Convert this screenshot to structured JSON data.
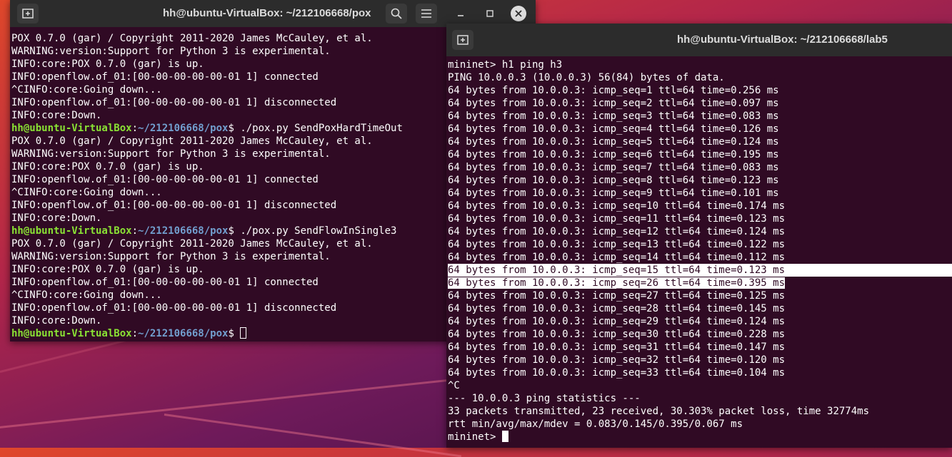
{
  "left_window": {
    "title": "hh@ubuntu-VirtualBox: ~/212106668/pox",
    "lines": [
      "POX 0.7.0 (gar) / Copyright 2011-2020 James McCauley, et al.",
      "WARNING:version:Support for Python 3 is experimental.",
      "INFO:core:POX 0.7.0 (gar) is up.",
      "INFO:openflow.of_01:[00-00-00-00-00-01 1] connected",
      "^CINFO:core:Going down...",
      "INFO:openflow.of_01:[00-00-00-00-00-01 1] disconnected",
      "INFO:core:Down.",
      {
        "user": "hh@ubuntu-VirtualBox",
        "path": "~/212106668/pox",
        "cmd": "./pox.py SendPoxHardTimeOut"
      },
      "POX 0.7.0 (gar) / Copyright 2011-2020 James McCauley, et al.",
      "WARNING:version:Support for Python 3 is experimental.",
      "INFO:core:POX 0.7.0 (gar) is up.",
      "INFO:openflow.of_01:[00-00-00-00-00-01 1] connected",
      "^CINFO:core:Going down...",
      "INFO:openflow.of_01:[00-00-00-00-00-01 1] disconnected",
      "INFO:core:Down.",
      {
        "user": "hh@ubuntu-VirtualBox",
        "path": "~/212106668/pox",
        "cmd": "./pox.py SendFlowInSingle3"
      },
      "POX 0.7.0 (gar) / Copyright 2011-2020 James McCauley, et al.",
      "WARNING:version:Support for Python 3 is experimental.",
      "INFO:core:POX 0.7.0 (gar) is up.",
      "INFO:openflow.of_01:[00-00-00-00-00-01 1] connected",
      "^CINFO:core:Going down...",
      "INFO:openflow.of_01:[00-00-00-00-00-01 1] disconnected",
      "INFO:core:Down.",
      {
        "user": "hh@ubuntu-VirtualBox",
        "path": "~/212106668/pox",
        "cmd": "",
        "cursor": "empty"
      }
    ]
  },
  "right_window": {
    "title": "hh@ubuntu-VirtualBox: ~/212106668/lab5",
    "lines": [
      "mininet> h1 ping h3",
      "PING 10.0.0.3 (10.0.0.3) 56(84) bytes of data.",
      "64 bytes from 10.0.0.3: icmp_seq=1 ttl=64 time=0.256 ms",
      "64 bytes from 10.0.0.3: icmp_seq=2 ttl=64 time=0.097 ms",
      "64 bytes from 10.0.0.3: icmp_seq=3 ttl=64 time=0.083 ms",
      "64 bytes from 10.0.0.3: icmp_seq=4 ttl=64 time=0.126 ms",
      "64 bytes from 10.0.0.3: icmp_seq=5 ttl=64 time=0.124 ms",
      "64 bytes from 10.0.0.3: icmp_seq=6 ttl=64 time=0.195 ms",
      "64 bytes from 10.0.0.3: icmp_seq=7 ttl=64 time=0.083 ms",
      "64 bytes from 10.0.0.3: icmp_seq=8 ttl=64 time=0.123 ms",
      "64 bytes from 10.0.0.3: icmp_seq=9 ttl=64 time=0.101 ms",
      "64 bytes from 10.0.0.3: icmp_seq=10 ttl=64 time=0.174 ms",
      "64 bytes from 10.0.0.3: icmp_seq=11 ttl=64 time=0.123 ms",
      "64 bytes from 10.0.0.3: icmp_seq=12 ttl=64 time=0.124 ms",
      "64 bytes from 10.0.0.3: icmp_seq=13 ttl=64 time=0.122 ms",
      "64 bytes from 10.0.0.3: icmp_seq=14 ttl=64 time=0.112 ms",
      {
        "text": "64 bytes from 10.0.0.3: icmp_seq=15 ttl=64 time=0.123 ms",
        "selected": "full"
      },
      {
        "text": "64 bytes from 10.0.0.3: icmp_seq=26 ttl=64 time=0.395 ms",
        "selected": "text"
      },
      "64 bytes from 10.0.0.3: icmp_seq=27 ttl=64 time=0.125 ms",
      "64 bytes from 10.0.0.3: icmp_seq=28 ttl=64 time=0.145 ms",
      "64 bytes from 10.0.0.3: icmp_seq=29 ttl=64 time=0.124 ms",
      "64 bytes from 10.0.0.3: icmp_seq=30 ttl=64 time=0.228 ms",
      "64 bytes from 10.0.0.3: icmp_seq=31 ttl=64 time=0.147 ms",
      "64 bytes from 10.0.0.3: icmp_seq=32 ttl=64 time=0.120 ms",
      "64 bytes from 10.0.0.3: icmp_seq=33 ttl=64 time=0.104 ms",
      "^C",
      "--- 10.0.0.3 ping statistics ---",
      "33 packets transmitted, 23 received, 30.303% packet loss, time 32774ms",
      "rtt min/avg/max/mdev = 0.083/0.145/0.395/0.067 ms",
      {
        "text": "mininet> ",
        "cursor": "block"
      }
    ]
  }
}
